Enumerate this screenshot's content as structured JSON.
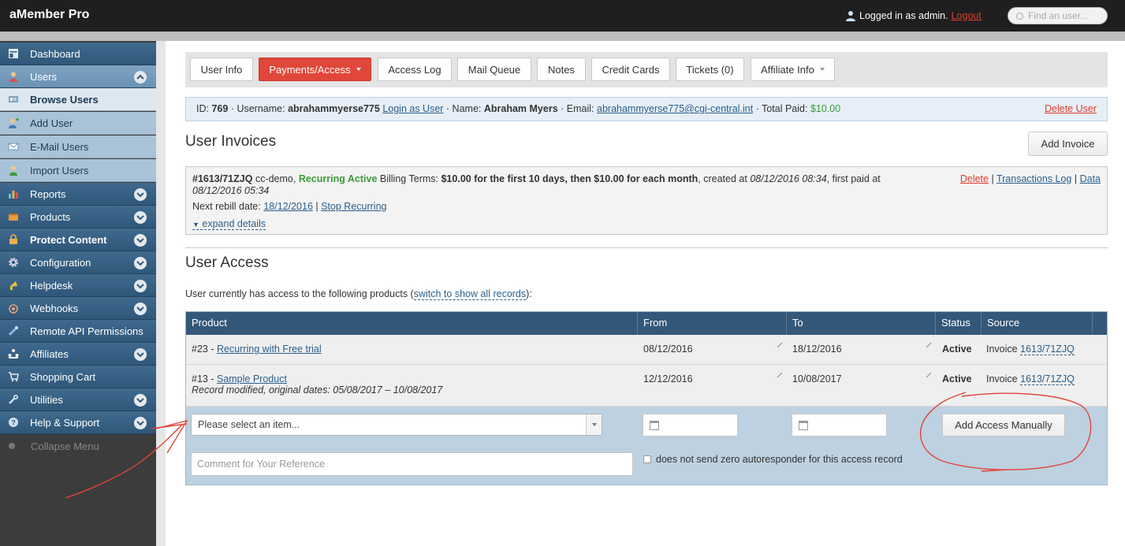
{
  "header": {
    "app_title": "aMember Pro",
    "logged_in_text": "Logged in as admin.",
    "logout_label": "Logout",
    "search_placeholder": "Find an user..."
  },
  "sidebar": {
    "items": [
      {
        "label": "Dashboard",
        "icon": "dashboard-icon"
      },
      {
        "label": "Users",
        "icon": "users-icon",
        "expanded": true
      },
      {
        "label": "Browse Users",
        "icon": "browse-users-icon",
        "active": true
      },
      {
        "label": "Add User",
        "icon": "add-user-icon"
      },
      {
        "label": "E-Mail Users",
        "icon": "email-icon"
      },
      {
        "label": "Import Users",
        "icon": "import-users-icon"
      },
      {
        "label": "Reports",
        "icon": "reports-icon"
      },
      {
        "label": "Products",
        "icon": "products-icon"
      },
      {
        "label": "Protect Content",
        "icon": "lock-icon"
      },
      {
        "label": "Configuration",
        "icon": "gear-icon"
      },
      {
        "label": "Helpdesk",
        "icon": "helpdesk-icon"
      },
      {
        "label": "Webhooks",
        "icon": "webhooks-icon"
      },
      {
        "label": "Remote API Permissions",
        "icon": "api-icon"
      },
      {
        "label": "Affiliates",
        "icon": "affiliates-icon"
      },
      {
        "label": "Shopping Cart",
        "icon": "cart-icon"
      },
      {
        "label": "Utilities",
        "icon": "wrench-icon"
      },
      {
        "label": "Help & Support",
        "icon": "help-icon"
      }
    ],
    "collapse_label": "Collapse Menu"
  },
  "tabs": [
    {
      "label": "User Info"
    },
    {
      "label": "Payments/Access",
      "active": true
    },
    {
      "label": "Access Log"
    },
    {
      "label": "Mail Queue"
    },
    {
      "label": "Notes"
    },
    {
      "label": "Credit Cards"
    },
    {
      "label": "Tickets (0)"
    },
    {
      "label": "Affiliate Info"
    }
  ],
  "user_info": {
    "id_label": "ID:",
    "id": "769",
    "username_label": "· Username:",
    "username": "abrahammyerse775",
    "login_as": "Login as User",
    "name_label": "· Name:",
    "name": "Abraham Myers",
    "email_label": "· Email:",
    "email": "abrahammyerse775@cgi-central.int",
    "paid_label": "· Total Paid:",
    "total_paid": "$10.00",
    "delete_label": "Delete User"
  },
  "invoices": {
    "title": "User Invoices",
    "add_label": "Add Invoice",
    "invoice": {
      "number": "#1613/71ZJQ",
      "paysys": "cc-demo,",
      "status": "Recurring Active",
      "terms_label": "Billing Terms:",
      "terms": "$10.00 for the first 10 days, then $10.00 for each month",
      "created_label": ", created at",
      "created": "08/12/2016 08:34",
      "first_paid_label": ", first paid at",
      "first_paid": "08/12/2016 05:34",
      "next_rebill_label": "Next rebill date:",
      "next_rebill": "18/12/2016",
      "stop_label": "Stop Recurring",
      "expand_label": "expand details",
      "delete_label": "Delete",
      "transactions_label": "Transactions Log",
      "data_label": "Data"
    }
  },
  "access": {
    "title": "User Access",
    "desc_prefix": "User currently has access to the following products (",
    "switch_label": "switch to show all records",
    "desc_suffix": "):",
    "columns": [
      "Product",
      "From",
      "To",
      "Status",
      "Source"
    ],
    "rows": [
      {
        "product_id": "#23 -",
        "product": "Recurring with Free trial",
        "from": "08/12/2016",
        "to": "18/12/2016",
        "status": "Active",
        "source_prefix": "Invoice",
        "source": "1613/71ZJQ",
        "note": ""
      },
      {
        "product_id": "#13 -",
        "product": "Sample Product",
        "from": "12/12/2016",
        "to": "10/08/2017",
        "status": "Active",
        "source_prefix": "Invoice",
        "source": "1613/71ZJQ",
        "note": "Record modified, original dates: 05/08/2017 – 10/08/2017"
      }
    ],
    "select_placeholder": "Please select an item...",
    "add_access_label": "Add Access Manually",
    "comment_placeholder": "Comment for Your Reference",
    "no_autoresponder_label": "does not send zero autoresponder for this access record"
  },
  "colors": {
    "header_bg": "#1f1f1f",
    "sidebar_nav": "#2f577a",
    "active_tab": "#e0473a",
    "annotation": "#e0453a",
    "grid_header": "#34587a"
  }
}
